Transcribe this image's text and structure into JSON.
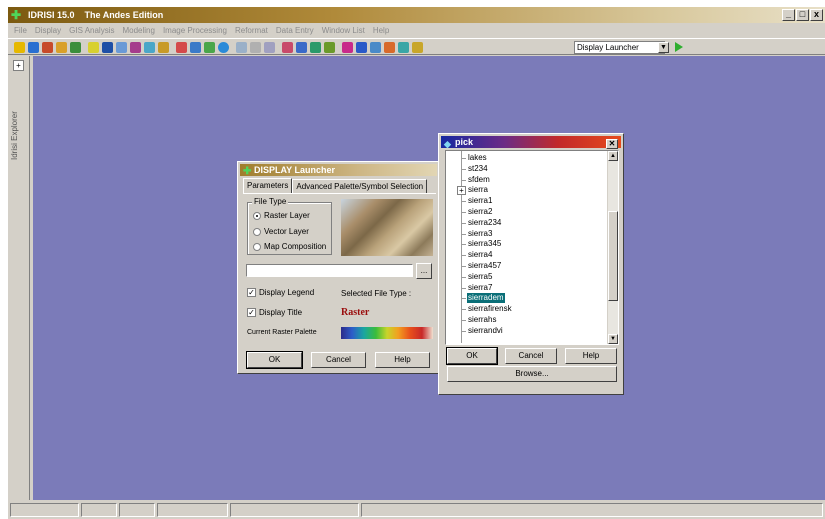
{
  "app": {
    "title": "IDRISI 15.0    The Andes Edition",
    "window_buttons": [
      "_",
      "□",
      "x"
    ],
    "menu": [
      "File",
      "Display",
      "GIS Analysis",
      "Modeling",
      "Image Processing",
      "Reformat",
      "Data Entry",
      "Window List",
      "Help"
    ],
    "toolbar_combo": "Display Launcher",
    "side_panel_label": "Idrisi Explorer"
  },
  "launcher": {
    "title": "DISPLAY Launcher",
    "tabs": [
      "Parameters",
      "Advanced Palette/Symbol Selection"
    ],
    "file_type_legend": "File Type",
    "file_types": [
      "Raster Layer",
      "Vector Layer",
      "Map Composition"
    ],
    "selected_file_type": "Raster Layer",
    "file_input_value": "",
    "browse_small_label": "...",
    "display_legend_label": "Display Legend",
    "display_legend_checked": true,
    "display_title_label": "Display Title",
    "display_title_checked": true,
    "selected_file_type_label": "Selected File Type :",
    "selected_file_type_value": "Raster",
    "palette_label": "Current Raster Palette",
    "ok": "OK",
    "cancel": "Cancel",
    "help": "Help"
  },
  "pick": {
    "title": "pick",
    "items": [
      "lakes",
      "st234",
      "sfdem",
      "sierra",
      "sierra1",
      "sierra2",
      "sierra234",
      "sierra3",
      "sierra345",
      "sierra4",
      "sierra457",
      "sierra5",
      "sierra7",
      "sierradem",
      "sierrafirensk",
      "sierrahs",
      "sierrandvi"
    ],
    "expandable_item": "sierra",
    "selected_item": "sierradem",
    "ok": "OK",
    "cancel": "Cancel",
    "help": "Help",
    "browse": "Browse..."
  }
}
